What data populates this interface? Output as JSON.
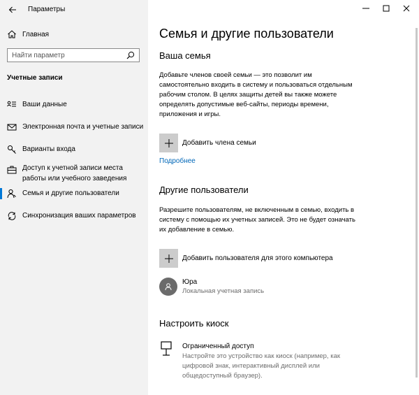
{
  "window": {
    "title": "Параметры",
    "controls": [
      "minimize",
      "maximize",
      "close"
    ]
  },
  "sidebar": {
    "home_label": "Главная",
    "search_placeholder": "Найти параметр",
    "section_label": "Учетные записи",
    "items": [
      {
        "label": "Ваши данные",
        "icon": "person-card-icon",
        "active": false
      },
      {
        "label": "Электронная почта и учетные записи",
        "icon": "mail-icon",
        "active": false
      },
      {
        "label": "Варианты входа",
        "icon": "key-icon",
        "active": false
      },
      {
        "label": "Доступ к учетной записи места работы или учебного заведения",
        "icon": "briefcase-icon",
        "active": false
      },
      {
        "label": "Семья и другие пользователи",
        "icon": "people-icon",
        "active": true
      },
      {
        "label": "Синхронизация ваших параметров",
        "icon": "sync-icon",
        "active": false
      }
    ]
  },
  "main": {
    "title": "Семья и другие пользователи",
    "family": {
      "heading": "Ваша семья",
      "description": "Добавьте членов своей семьи — это позволит им самостоятельно входить в систему и пользоваться отдельным рабочим столом. В целях защиты детей вы также можете определять допустимые веб-сайты, периоды времени, приложения и игры.",
      "add_label": "Добавить члена семьи",
      "more_link": "Подробнее"
    },
    "others": {
      "heading": "Другие пользователи",
      "description": "Разрешите пользователям, не включенным в семью, входить в систему с помощью их учетных записей. Это не будет означать их добавление в семью.",
      "add_label": "Добавить пользователя для этого компьютера",
      "user": {
        "name": "Юра",
        "type": "Локальная учетная запись"
      }
    },
    "kiosk": {
      "heading": "Настроить киоск",
      "title": "Ограниченный доступ",
      "description": "Настройте это устройство как киоск (например, как цифровой знак, интерактивный дисплей или общедоступный браузер)."
    }
  },
  "colors": {
    "accent": "#0078d7",
    "link": "#0067b8",
    "sidebar_bg": "#f2f2f2",
    "plus_bg": "#cccccc",
    "avatar_bg": "#6b6b6b"
  }
}
